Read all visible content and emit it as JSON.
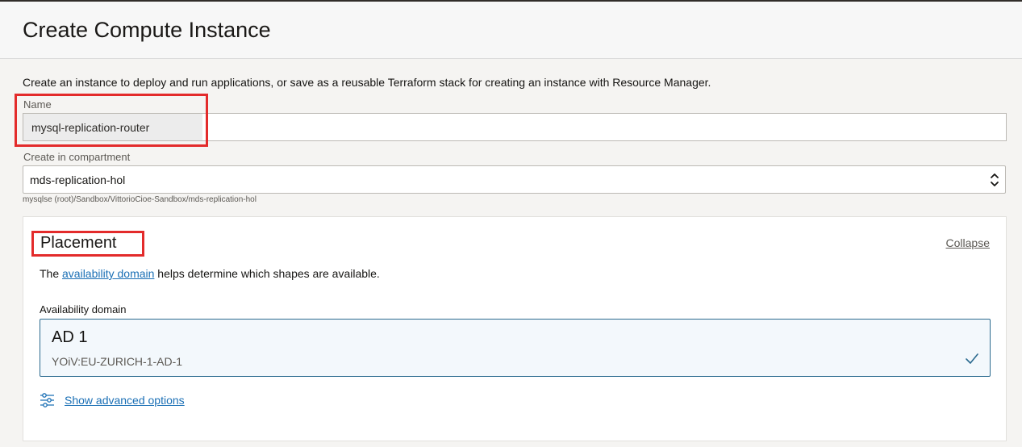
{
  "header": {
    "title": "Create Compute Instance"
  },
  "intro": "Create an instance to deploy and run applications, or save as a reusable Terraform stack for creating an instance with Resource Manager.",
  "name_field": {
    "label": "Name",
    "value": "mysql-replication-router"
  },
  "compartment": {
    "label": "Create in compartment",
    "value": "mds-replication-hol",
    "path": "mysqlse (root)/Sandbox/VittorioCioe-Sandbox/mds-replication-hol"
  },
  "placement": {
    "title": "Placement",
    "collapse_label": "Collapse",
    "desc_prefix": "The ",
    "desc_link": "availability domain",
    "desc_suffix": " helps determine which shapes are available.",
    "ad_label": "Availability domain",
    "ad_card": {
      "name": "AD 1",
      "sub": "YOiV:EU-ZURICH-1-AD-1",
      "selected": true
    },
    "advanced_label": "Show advanced options"
  },
  "colors": {
    "highlight": "#e32b2b",
    "link": "#1a6fb5",
    "selected_border": "#2b6a8f"
  },
  "icons": [
    "chevron-updown-icon",
    "checkmark-icon",
    "sliders-icon"
  ]
}
